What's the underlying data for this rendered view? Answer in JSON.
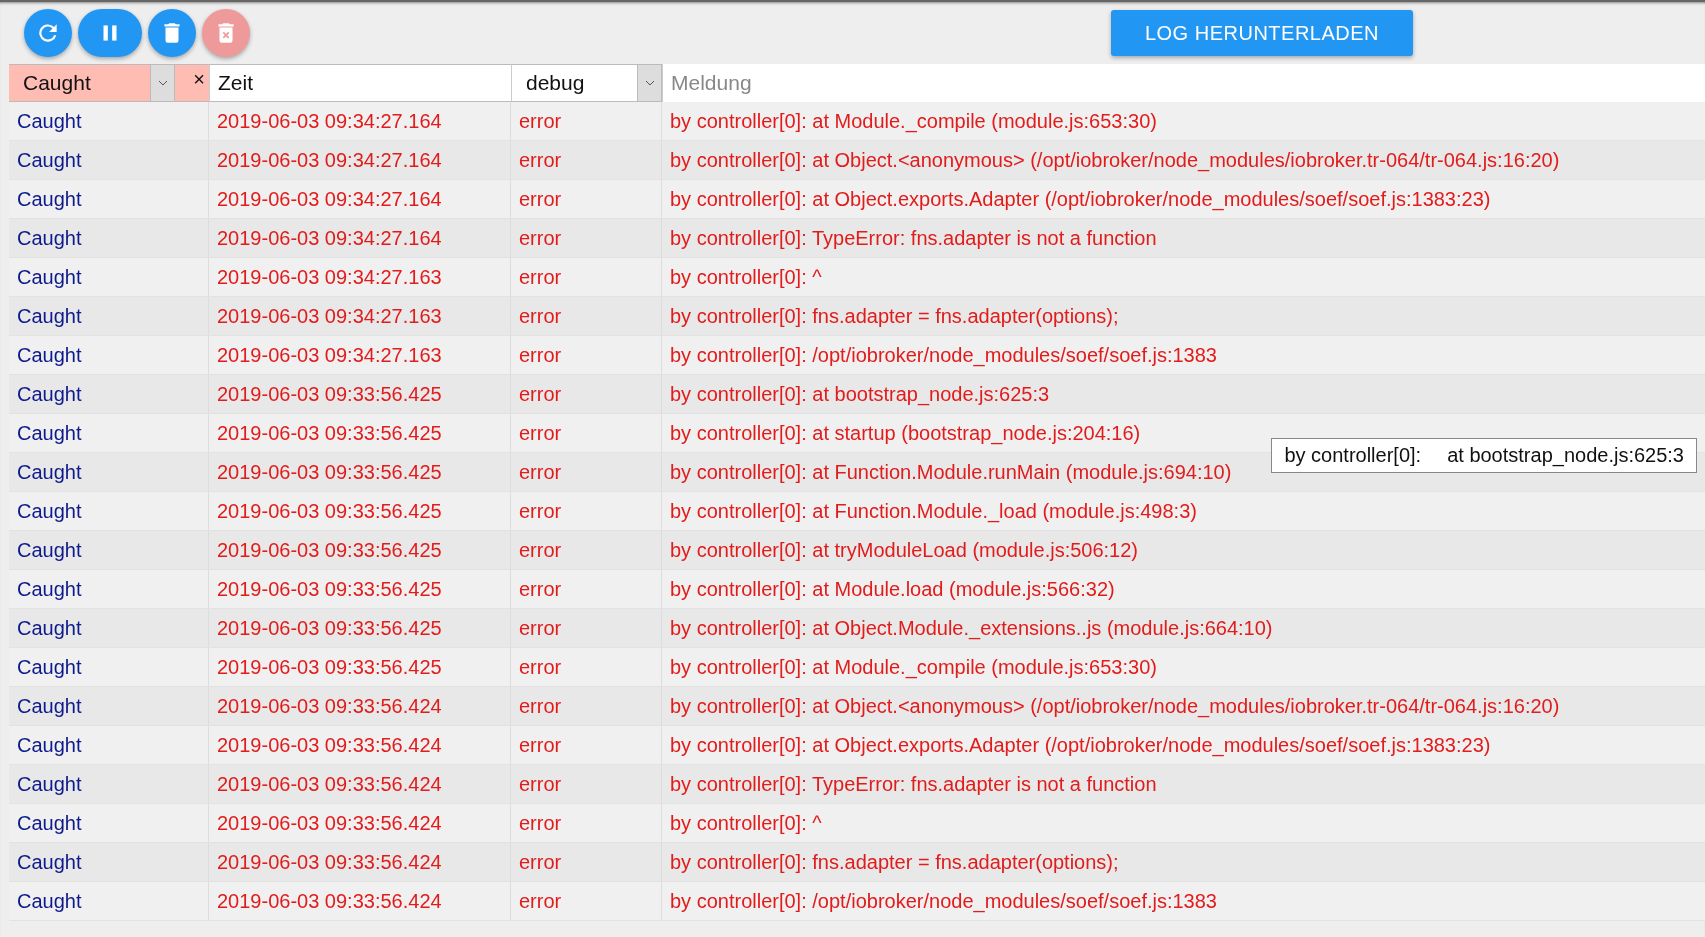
{
  "toolbar": {
    "buttons": [
      {
        "kind": "refresh",
        "disabled": false
      },
      {
        "kind": "pause",
        "disabled": false
      },
      {
        "kind": "delete",
        "disabled": false
      },
      {
        "kind": "delete-all",
        "disabled": true
      }
    ],
    "download_button": "LOG HERUNTERLADEN"
  },
  "filters": {
    "source": {
      "value": "Caught",
      "active": true,
      "clear": "×"
    },
    "time": {
      "value": "Zeit"
    },
    "severity": {
      "value": "debug"
    },
    "message": {
      "placeholder": "Meldung"
    }
  },
  "rows": [
    {
      "source": "Caught",
      "time": "2019-06-03 09:34:27.164",
      "severity": "error",
      "message": "by controller[0]: at Module._compile (module.js:653:30)"
    },
    {
      "source": "Caught",
      "time": "2019-06-03 09:34:27.164",
      "severity": "error",
      "message": "by controller[0]: at Object.<anonymous> (/opt/iobroker/node_modules/iobroker.tr-064/tr-064.js:16:20)"
    },
    {
      "source": "Caught",
      "time": "2019-06-03 09:34:27.164",
      "severity": "error",
      "message": "by controller[0]: at Object.exports.Adapter (/opt/iobroker/node_modules/soef/soef.js:1383:23)"
    },
    {
      "source": "Caught",
      "time": "2019-06-03 09:34:27.164",
      "severity": "error",
      "message": "by controller[0]: TypeError: fns.adapter is not a function"
    },
    {
      "source": "Caught",
      "time": "2019-06-03 09:34:27.163",
      "severity": "error",
      "message": "by controller[0]: ^"
    },
    {
      "source": "Caught",
      "time": "2019-06-03 09:34:27.163",
      "severity": "error",
      "message": "by controller[0]: fns.adapter = fns.adapter(options);"
    },
    {
      "source": "Caught",
      "time": "2019-06-03 09:34:27.163",
      "severity": "error",
      "message": "by controller[0]: /opt/iobroker/node_modules/soef/soef.js:1383"
    },
    {
      "source": "Caught",
      "time": "2019-06-03 09:33:56.425",
      "severity": "error",
      "message": "by controller[0]: at bootstrap_node.js:625:3"
    },
    {
      "source": "Caught",
      "time": "2019-06-03 09:33:56.425",
      "severity": "error",
      "message": "by controller[0]: at startup (bootstrap_node.js:204:16)"
    },
    {
      "source": "Caught",
      "time": "2019-06-03 09:33:56.425",
      "severity": "error",
      "message": "by controller[0]: at Function.Module.runMain (module.js:694:10)"
    },
    {
      "source": "Caught",
      "time": "2019-06-03 09:33:56.425",
      "severity": "error",
      "message": "by controller[0]: at Function.Module._load (module.js:498:3)"
    },
    {
      "source": "Caught",
      "time": "2019-06-03 09:33:56.425",
      "severity": "error",
      "message": "by controller[0]: at tryModuleLoad (module.js:506:12)"
    },
    {
      "source": "Caught",
      "time": "2019-06-03 09:33:56.425",
      "severity": "error",
      "message": "by controller[0]: at Module.load (module.js:566:32)"
    },
    {
      "source": "Caught",
      "time": "2019-06-03 09:33:56.425",
      "severity": "error",
      "message": "by controller[0]: at Object.Module._extensions..js (module.js:664:10)"
    },
    {
      "source": "Caught",
      "time": "2019-06-03 09:33:56.425",
      "severity": "error",
      "message": "by controller[0]: at Module._compile (module.js:653:30)"
    },
    {
      "source": "Caught",
      "time": "2019-06-03 09:33:56.424",
      "severity": "error",
      "message": "by controller[0]: at Object.<anonymous> (/opt/iobroker/node_modules/iobroker.tr-064/tr-064.js:16:20)"
    },
    {
      "source": "Caught",
      "time": "2019-06-03 09:33:56.424",
      "severity": "error",
      "message": "by controller[0]: at Object.exports.Adapter (/opt/iobroker/node_modules/soef/soef.js:1383:23)"
    },
    {
      "source": "Caught",
      "time": "2019-06-03 09:33:56.424",
      "severity": "error",
      "message": "by controller[0]: TypeError: fns.adapter is not a function"
    },
    {
      "source": "Caught",
      "time": "2019-06-03 09:33:56.424",
      "severity": "error",
      "message": "by controller[0]: ^"
    },
    {
      "source": "Caught",
      "time": "2019-06-03 09:33:56.424",
      "severity": "error",
      "message": "by controller[0]: fns.adapter = fns.adapter(options);"
    },
    {
      "source": "Caught",
      "time": "2019-06-03 09:33:56.424",
      "severity": "error",
      "message": "by controller[0]: /opt/iobroker/node_modules/soef/soef.js:1383"
    }
  ],
  "tooltip": {
    "source": "by controller[0]:",
    "text": "at bootstrap_node.js:625:3"
  }
}
